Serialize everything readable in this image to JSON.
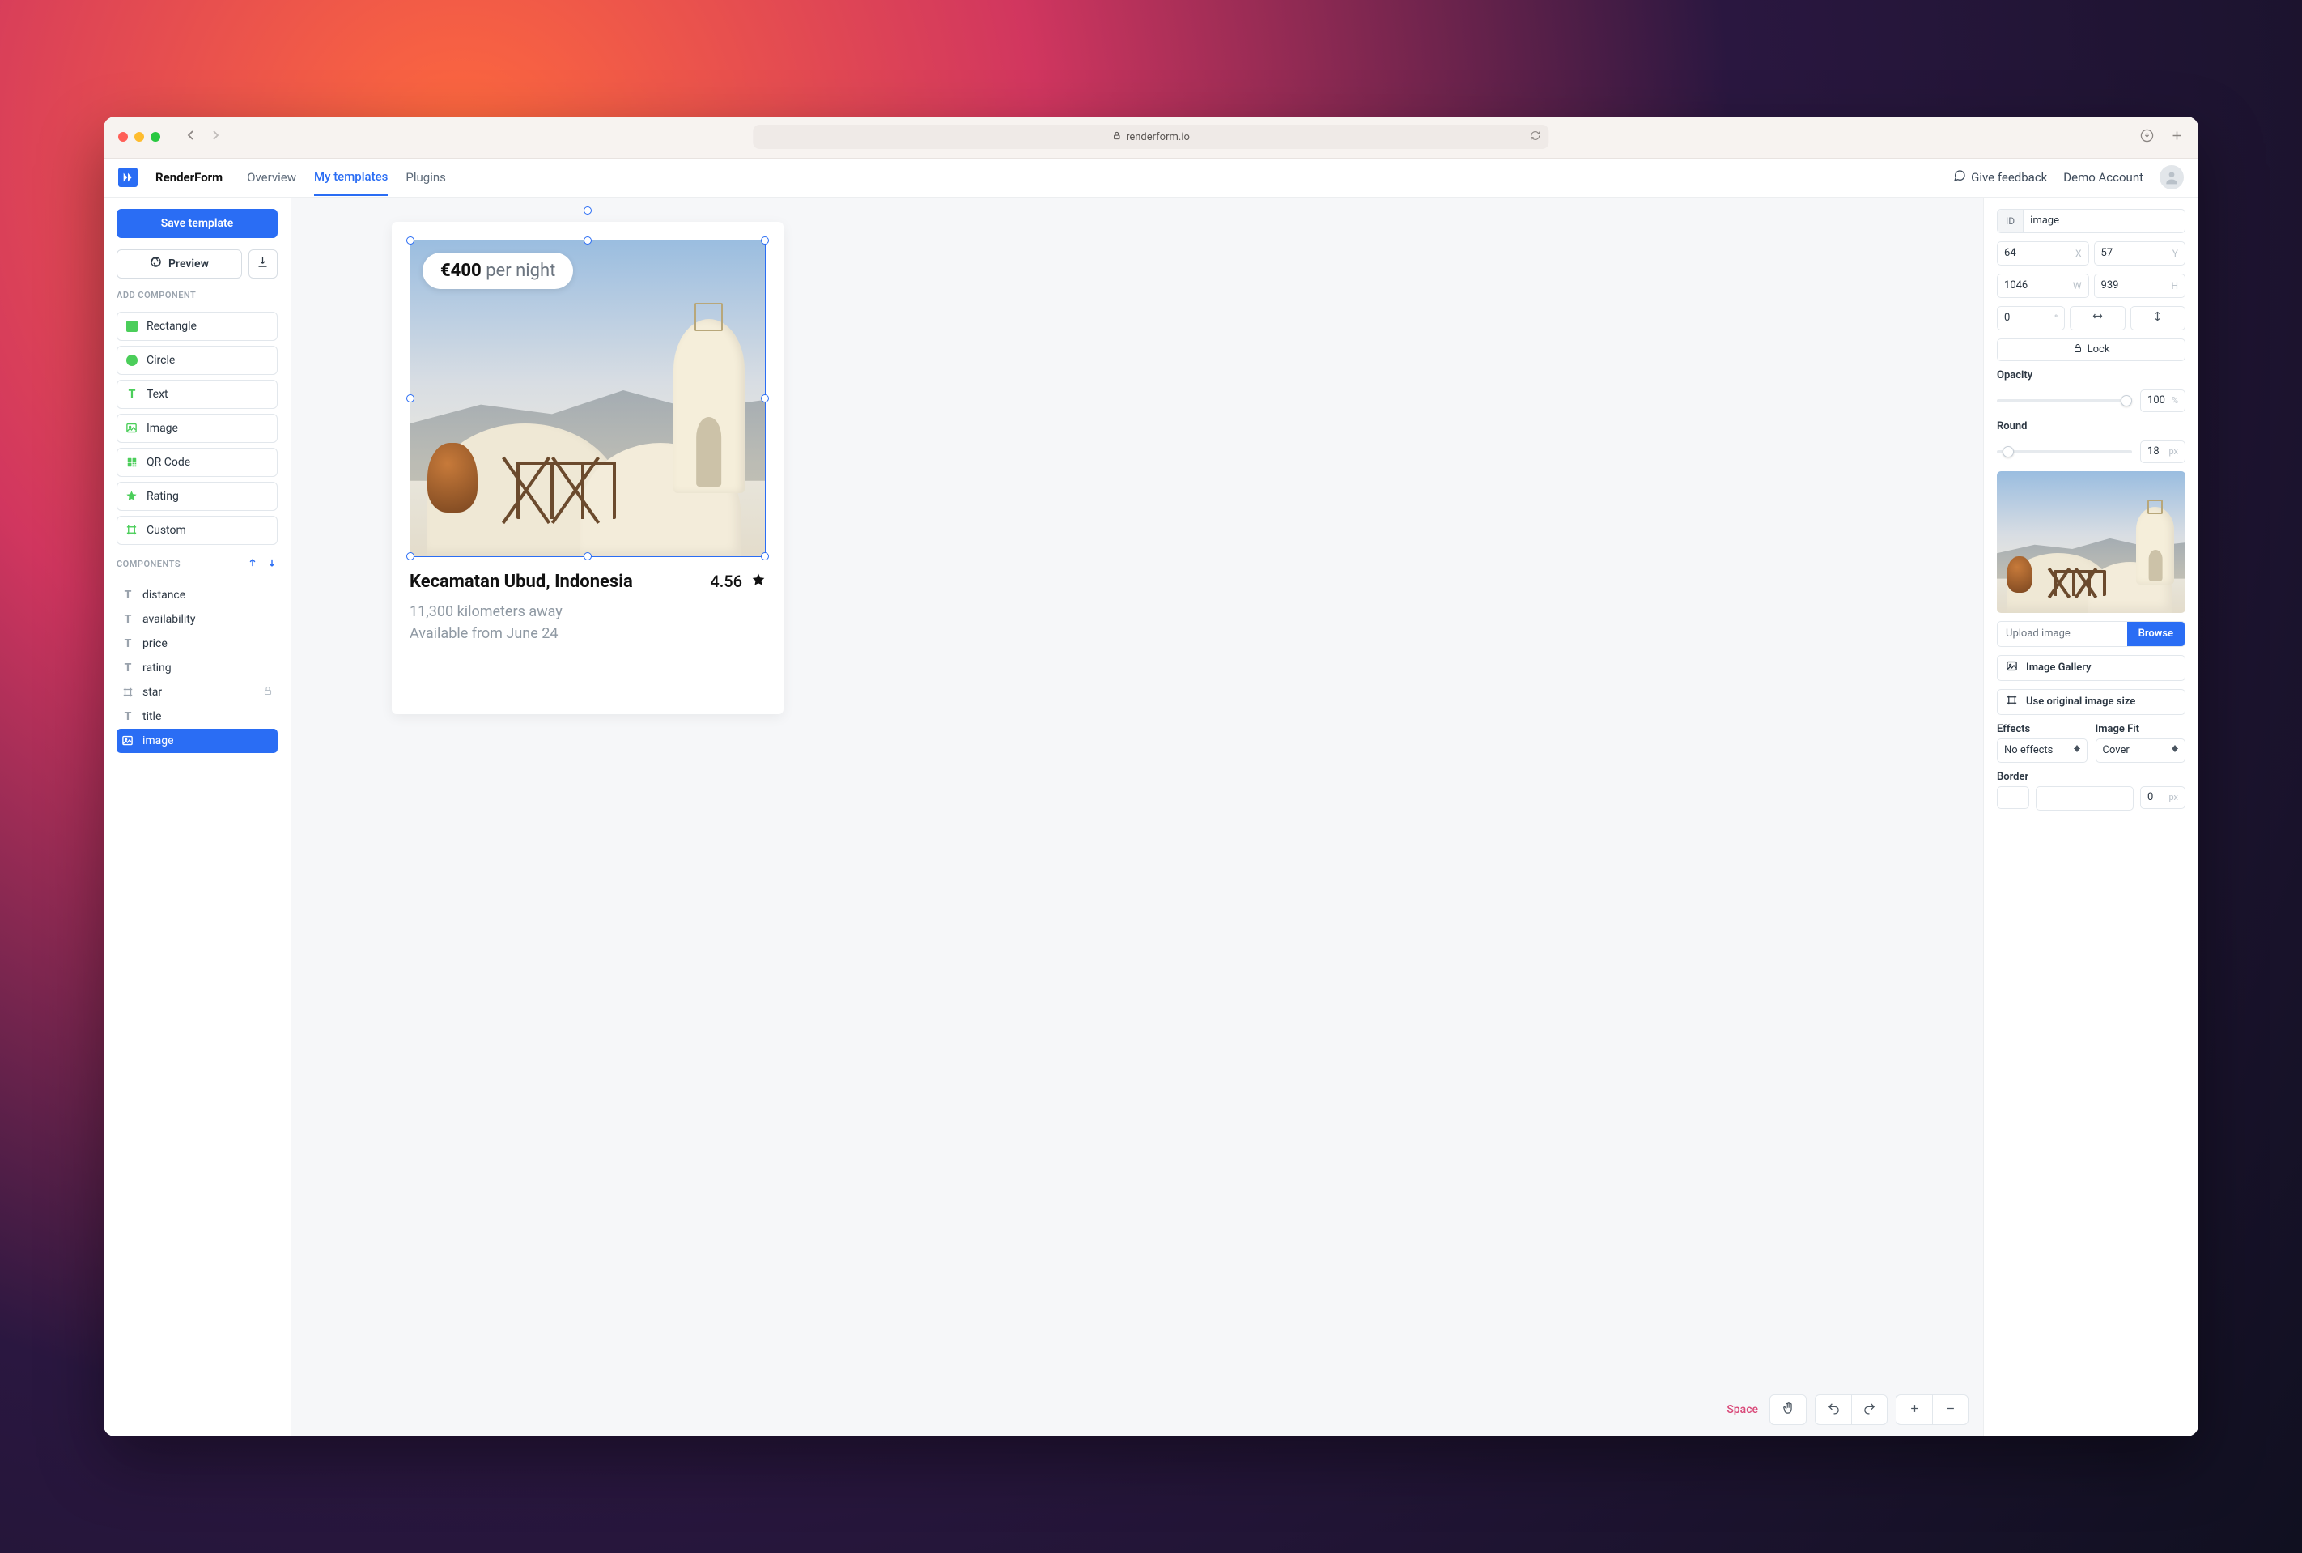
{
  "browser": {
    "url": "renderform.io"
  },
  "app": {
    "brand": "RenderForm",
    "nav": {
      "overview": "Overview",
      "my_templates": "My templates",
      "plugins": "Plugins"
    },
    "feedback": "Give feedback",
    "account": "Demo Account"
  },
  "left": {
    "save": "Save template",
    "preview": "Preview",
    "add_label": "ADD COMPONENT",
    "components_label": "COMPONENTS",
    "add": {
      "rectangle": "Rectangle",
      "circle": "Circle",
      "text": "Text",
      "image": "Image",
      "qrcode": "QR Code",
      "rating": "Rating",
      "custom": "Custom"
    },
    "layers": [
      {
        "type": "text",
        "name": "distance"
      },
      {
        "type": "text",
        "name": "availability"
      },
      {
        "type": "text",
        "name": "price"
      },
      {
        "type": "text",
        "name": "rating"
      },
      {
        "type": "frame",
        "name": "star",
        "locked": true
      },
      {
        "type": "text",
        "name": "title"
      },
      {
        "type": "image",
        "name": "image",
        "selected": true
      }
    ]
  },
  "card": {
    "price_amount": "€400",
    "price_suffix": " per night",
    "title": "Kecamatan Ubud, Indonesia",
    "rating": "4.56",
    "distance": "11,300 kilometers away",
    "availability": "Available from June 24"
  },
  "toolbar": {
    "space": "Space"
  },
  "right": {
    "id_prefix": "ID",
    "id": "image",
    "x": "64",
    "x_suffix": "X",
    "y": "57",
    "y_suffix": "Y",
    "w": "1046",
    "w_suffix": "W",
    "h": "939",
    "h_suffix": "H",
    "rot": "0",
    "rot_suffix": "°",
    "lock": "Lock",
    "opacity_label": "Opacity",
    "opacity": "100",
    "opacity_suffix": "%",
    "round_label": "Round",
    "round": "18",
    "round_suffix": "px",
    "upload_label": "Upload image",
    "browse": "Browse",
    "gallery": "Image Gallery",
    "orig": "Use original image size",
    "effects_label": "Effects",
    "effects_value": "No effects",
    "fit_label": "Image Fit",
    "fit_value": "Cover",
    "border_label": "Border",
    "border_width": "0",
    "border_suffix": "px"
  }
}
